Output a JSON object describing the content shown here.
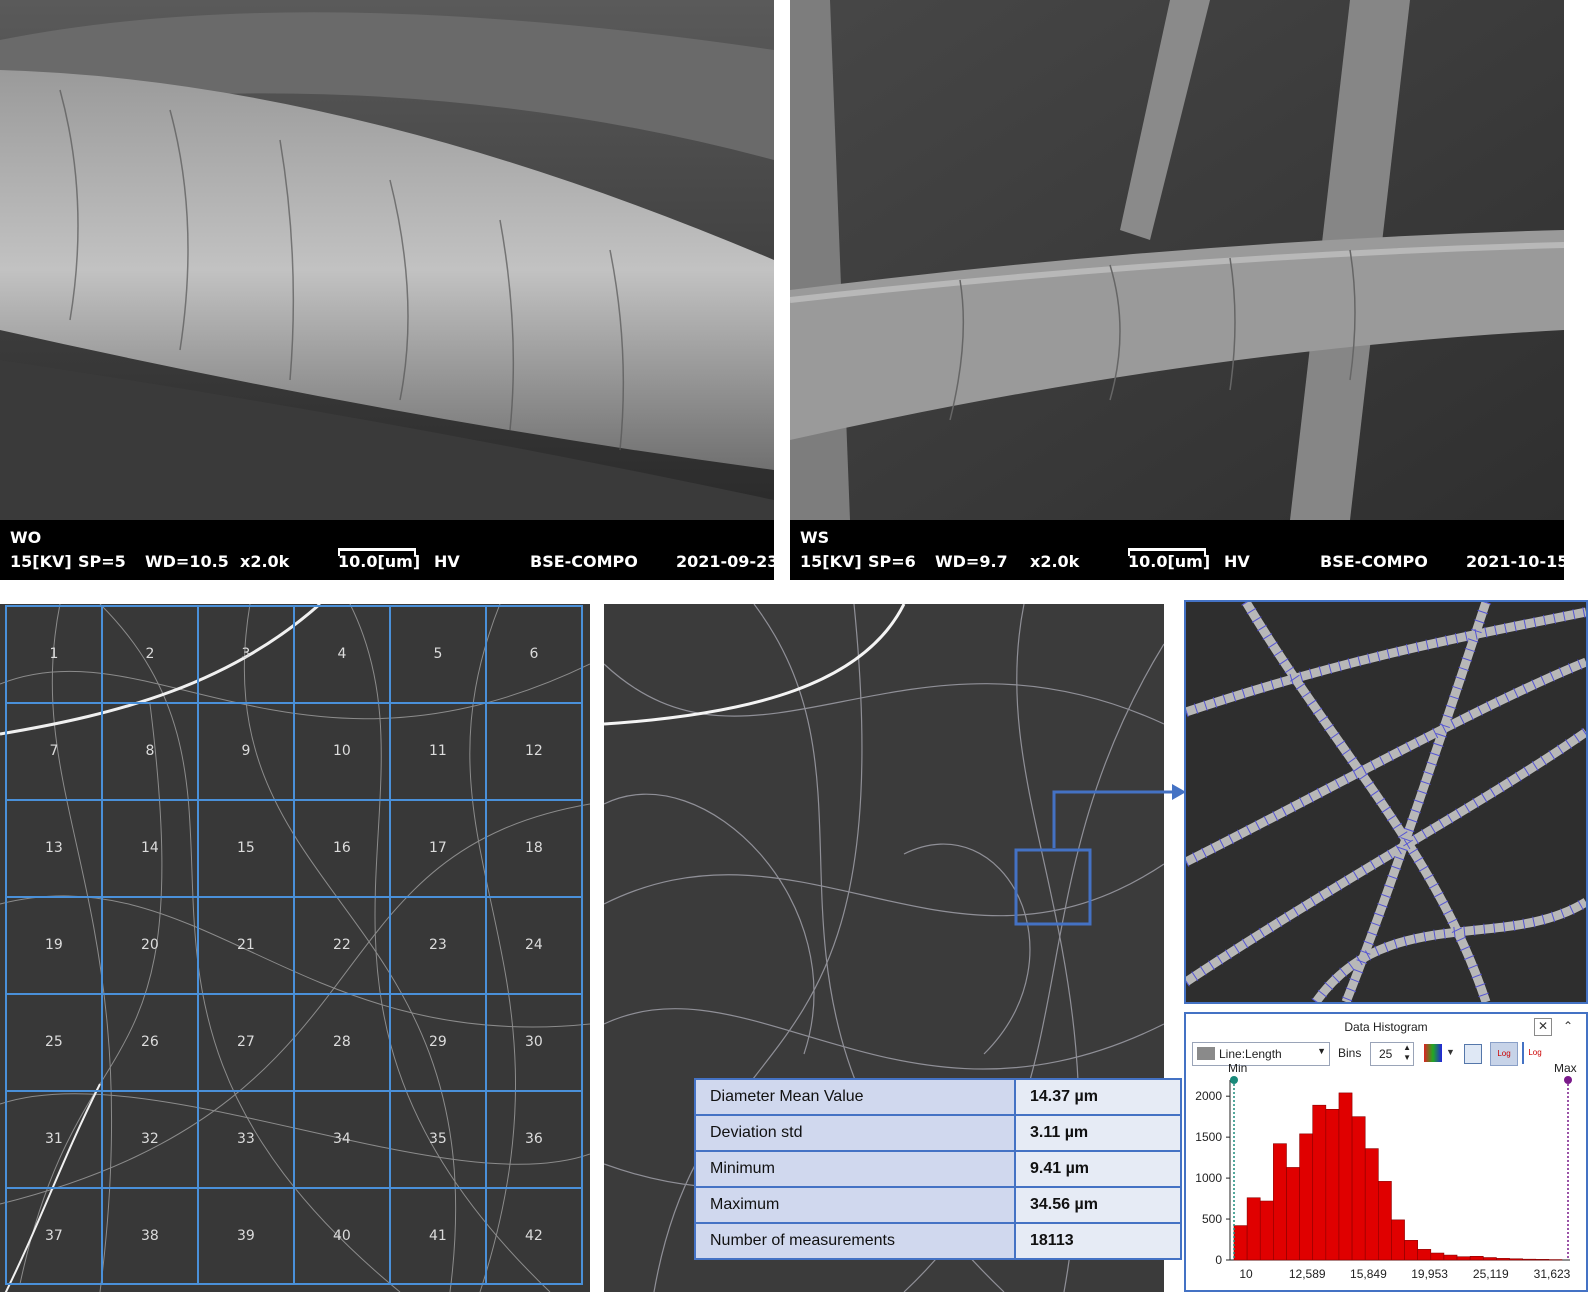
{
  "sem_left": {
    "label": "WO",
    "kv": "15[KV]",
    "sp": "SP=5",
    "wd": "WD=10.5",
    "mag": "x2.0k",
    "scale": "10.0[um]",
    "hv": "HV",
    "mode": "BSE-COMPO",
    "date": "2021-09-23"
  },
  "sem_right": {
    "label": "WS",
    "kv": "15[KV]",
    "sp": "SP=6",
    "wd": "WD=9.7",
    "mag": "x2.0k",
    "scale": "10.0[um]",
    "hv": "HV",
    "mode": "BSE-COMPO",
    "date": "2021-10-15"
  },
  "grid": {
    "cells": [
      "1",
      "2",
      "3",
      "4",
      "5",
      "6",
      "7",
      "8",
      "9",
      "10",
      "11",
      "12",
      "13",
      "14",
      "15",
      "16",
      "17",
      "18",
      "19",
      "20",
      "21",
      "22",
      "23",
      "24",
      "25",
      "26",
      "27",
      "28",
      "29",
      "30",
      "31",
      "32",
      "33",
      "34",
      "35",
      "36",
      "37",
      "38",
      "39",
      "40",
      "41",
      "42"
    ]
  },
  "stats": {
    "rows": [
      {
        "key": "Diameter Mean Value",
        "value": "14.37 µm"
      },
      {
        "key": "Deviation std",
        "value": "3.11 µm"
      },
      {
        "key": "Minimum",
        "value": "9.41 µm"
      },
      {
        "key": "Maximum",
        "value": "34.56 µm"
      },
      {
        "key": "Number of measurements",
        "value": "18113"
      }
    ]
  },
  "histogram": {
    "title": "Data Histogram",
    "field": "Line:Length",
    "bins_label": "Bins",
    "bins_value": "25",
    "min_label": "Min",
    "max_label": "Max",
    "colors": {
      "bar": "#e00000",
      "accent": "#4472c4"
    }
  },
  "chart_data": {
    "type": "bar",
    "title": "Data Histogram",
    "xlabel": "",
    "ylabel": "",
    "x_tick_labels": [
      "10",
      "12,589",
      "15,849",
      "19,953",
      "25,119",
      "31,623"
    ],
    "y_ticks": [
      0,
      500,
      1000,
      1500,
      2000
    ],
    "ylim": [
      0,
      2100
    ],
    "values": [
      420,
      760,
      720,
      1420,
      1130,
      1540,
      1890,
      1840,
      2040,
      1750,
      1360,
      960,
      490,
      240,
      130,
      85,
      60,
      40,
      45,
      30,
      20,
      15,
      10,
      8,
      5
    ]
  }
}
